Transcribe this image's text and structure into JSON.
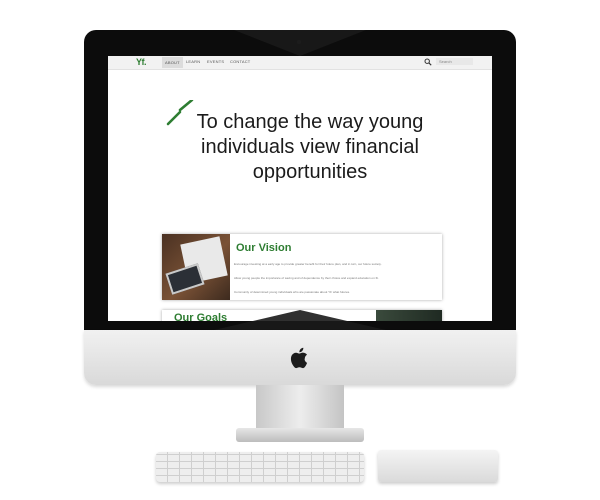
{
  "navbar": {
    "logo": "Yf.",
    "items": [
      {
        "label": "ABOUT",
        "active": true
      },
      {
        "label": "LEARN",
        "active": false
      },
      {
        "label": "EVENTS",
        "active": false
      },
      {
        "label": "CONTACT",
        "active": false
      }
    ],
    "search_placeholder": "Search"
  },
  "hero": {
    "heading": "To change the way young individuals view financial opportunities"
  },
  "vision_card": {
    "title": "Our Vision",
    "lines": [
      "Encourage investing at a early age to provide greater benefit for their future plan, and in turn, our future society.",
      "Allow young people the importance of saving and of dependence by their choice and expand education on fit.",
      "Community of determined young individuals who are passionate about YF what futures."
    ]
  },
  "goals_card": {
    "title": "Our Goals"
  },
  "colors": {
    "accent": "#2e7d32",
    "bezel": "#0c0c0c"
  }
}
